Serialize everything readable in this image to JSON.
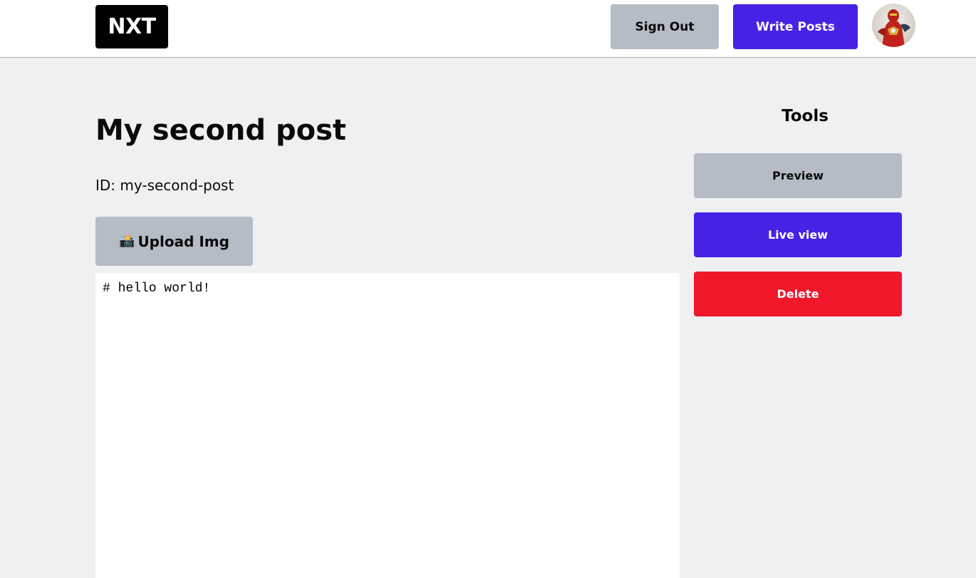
{
  "navbar": {
    "logo_text": "NXT",
    "sign_out_label": "Sign Out",
    "write_posts_label": "Write Posts",
    "avatar_icon": "user-avatar-icon"
  },
  "post": {
    "title": "My second post",
    "id_text": "ID: my-second-post",
    "upload_icon": "camera-icon",
    "upload_emoji": "📸",
    "upload_label": "Upload Img",
    "content": "# hello world!"
  },
  "tools": {
    "title": "Tools",
    "preview_label": "Preview",
    "live_view_label": "Live view",
    "delete_label": "Delete"
  },
  "colors": {
    "primary": "#4821e6",
    "gray": "#b5bcc6",
    "danger": "#f0172a",
    "background": "#eef0f2"
  }
}
